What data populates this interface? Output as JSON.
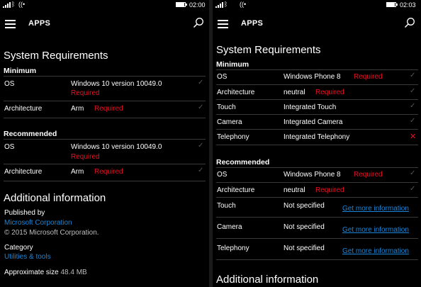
{
  "colors": {
    "accent": "#1a86d9",
    "required": "#e81123",
    "background": "#000000"
  },
  "left": {
    "status": {
      "time": "02:00",
      "icons": [
        "signal-icon",
        "bluetooth-icon",
        "wifi-icon",
        "battery-icon"
      ],
      "battery_level": 0.9
    },
    "app_bar": {
      "title": "APPS"
    },
    "system_requirements": {
      "title": "System Requirements",
      "minimum": {
        "label": "Minimum",
        "rows": [
          {
            "name": "OS",
            "value": "Windows 10 version 10049.0",
            "required": "Required"
          },
          {
            "name": "Architecture",
            "value": "Arm",
            "required": "Required"
          }
        ]
      },
      "recommended": {
        "label": "Recommended",
        "rows": [
          {
            "name": "OS",
            "value": "Windows 10 version 10049.0",
            "required": "Required"
          },
          {
            "name": "Architecture",
            "value": "Arm",
            "required": "Required"
          }
        ]
      }
    },
    "additional": {
      "title": "Additional information",
      "published_by_label": "Published by",
      "publisher": "Microsoft Corporation",
      "copyright": "© 2015 Microsoft Corporation.",
      "category_label": "Category",
      "category": "Utilities & tools",
      "size_label": "Approximate size",
      "size_value": "48.4 MB"
    }
  },
  "right": {
    "status": {
      "time": "02:03",
      "icons": [
        "signal-icon",
        "bluetooth-icon",
        "wifi-icon",
        "battery-icon"
      ],
      "battery_level": 0.9
    },
    "app_bar": {
      "title": "APPS"
    },
    "system_requirements": {
      "title": "System Requirements",
      "minimum": {
        "label": "Minimum",
        "rows": [
          {
            "name": "OS",
            "value": "Windows Phone 8",
            "required": "Required",
            "status": "check"
          },
          {
            "name": "Architecture",
            "value": "neutral",
            "required": "Required",
            "status": "check"
          },
          {
            "name": "Touch",
            "value": "Integrated Touch",
            "required": "",
            "status": "check"
          },
          {
            "name": "Camera",
            "value": "Integrated Camera",
            "required": "",
            "status": "check"
          },
          {
            "name": "Telephony",
            "value": "Integrated Telephony",
            "required": "",
            "status": "cross"
          }
        ]
      },
      "recommended": {
        "label": "Recommended",
        "rows": [
          {
            "name": "OS",
            "value": "Windows Phone 8",
            "required": "Required",
            "status": "check"
          },
          {
            "name": "Architecture",
            "value": "neutral",
            "required": "Required",
            "status": "check"
          },
          {
            "name": "Touch",
            "value": "Not specified",
            "link": "Get more information"
          },
          {
            "name": "Camera",
            "value": "Not specified",
            "link": "Get more information"
          },
          {
            "name": "Telephony",
            "value": "Not specified",
            "link": "Get more information"
          }
        ]
      }
    },
    "additional": {
      "title": "Additional information"
    }
  }
}
